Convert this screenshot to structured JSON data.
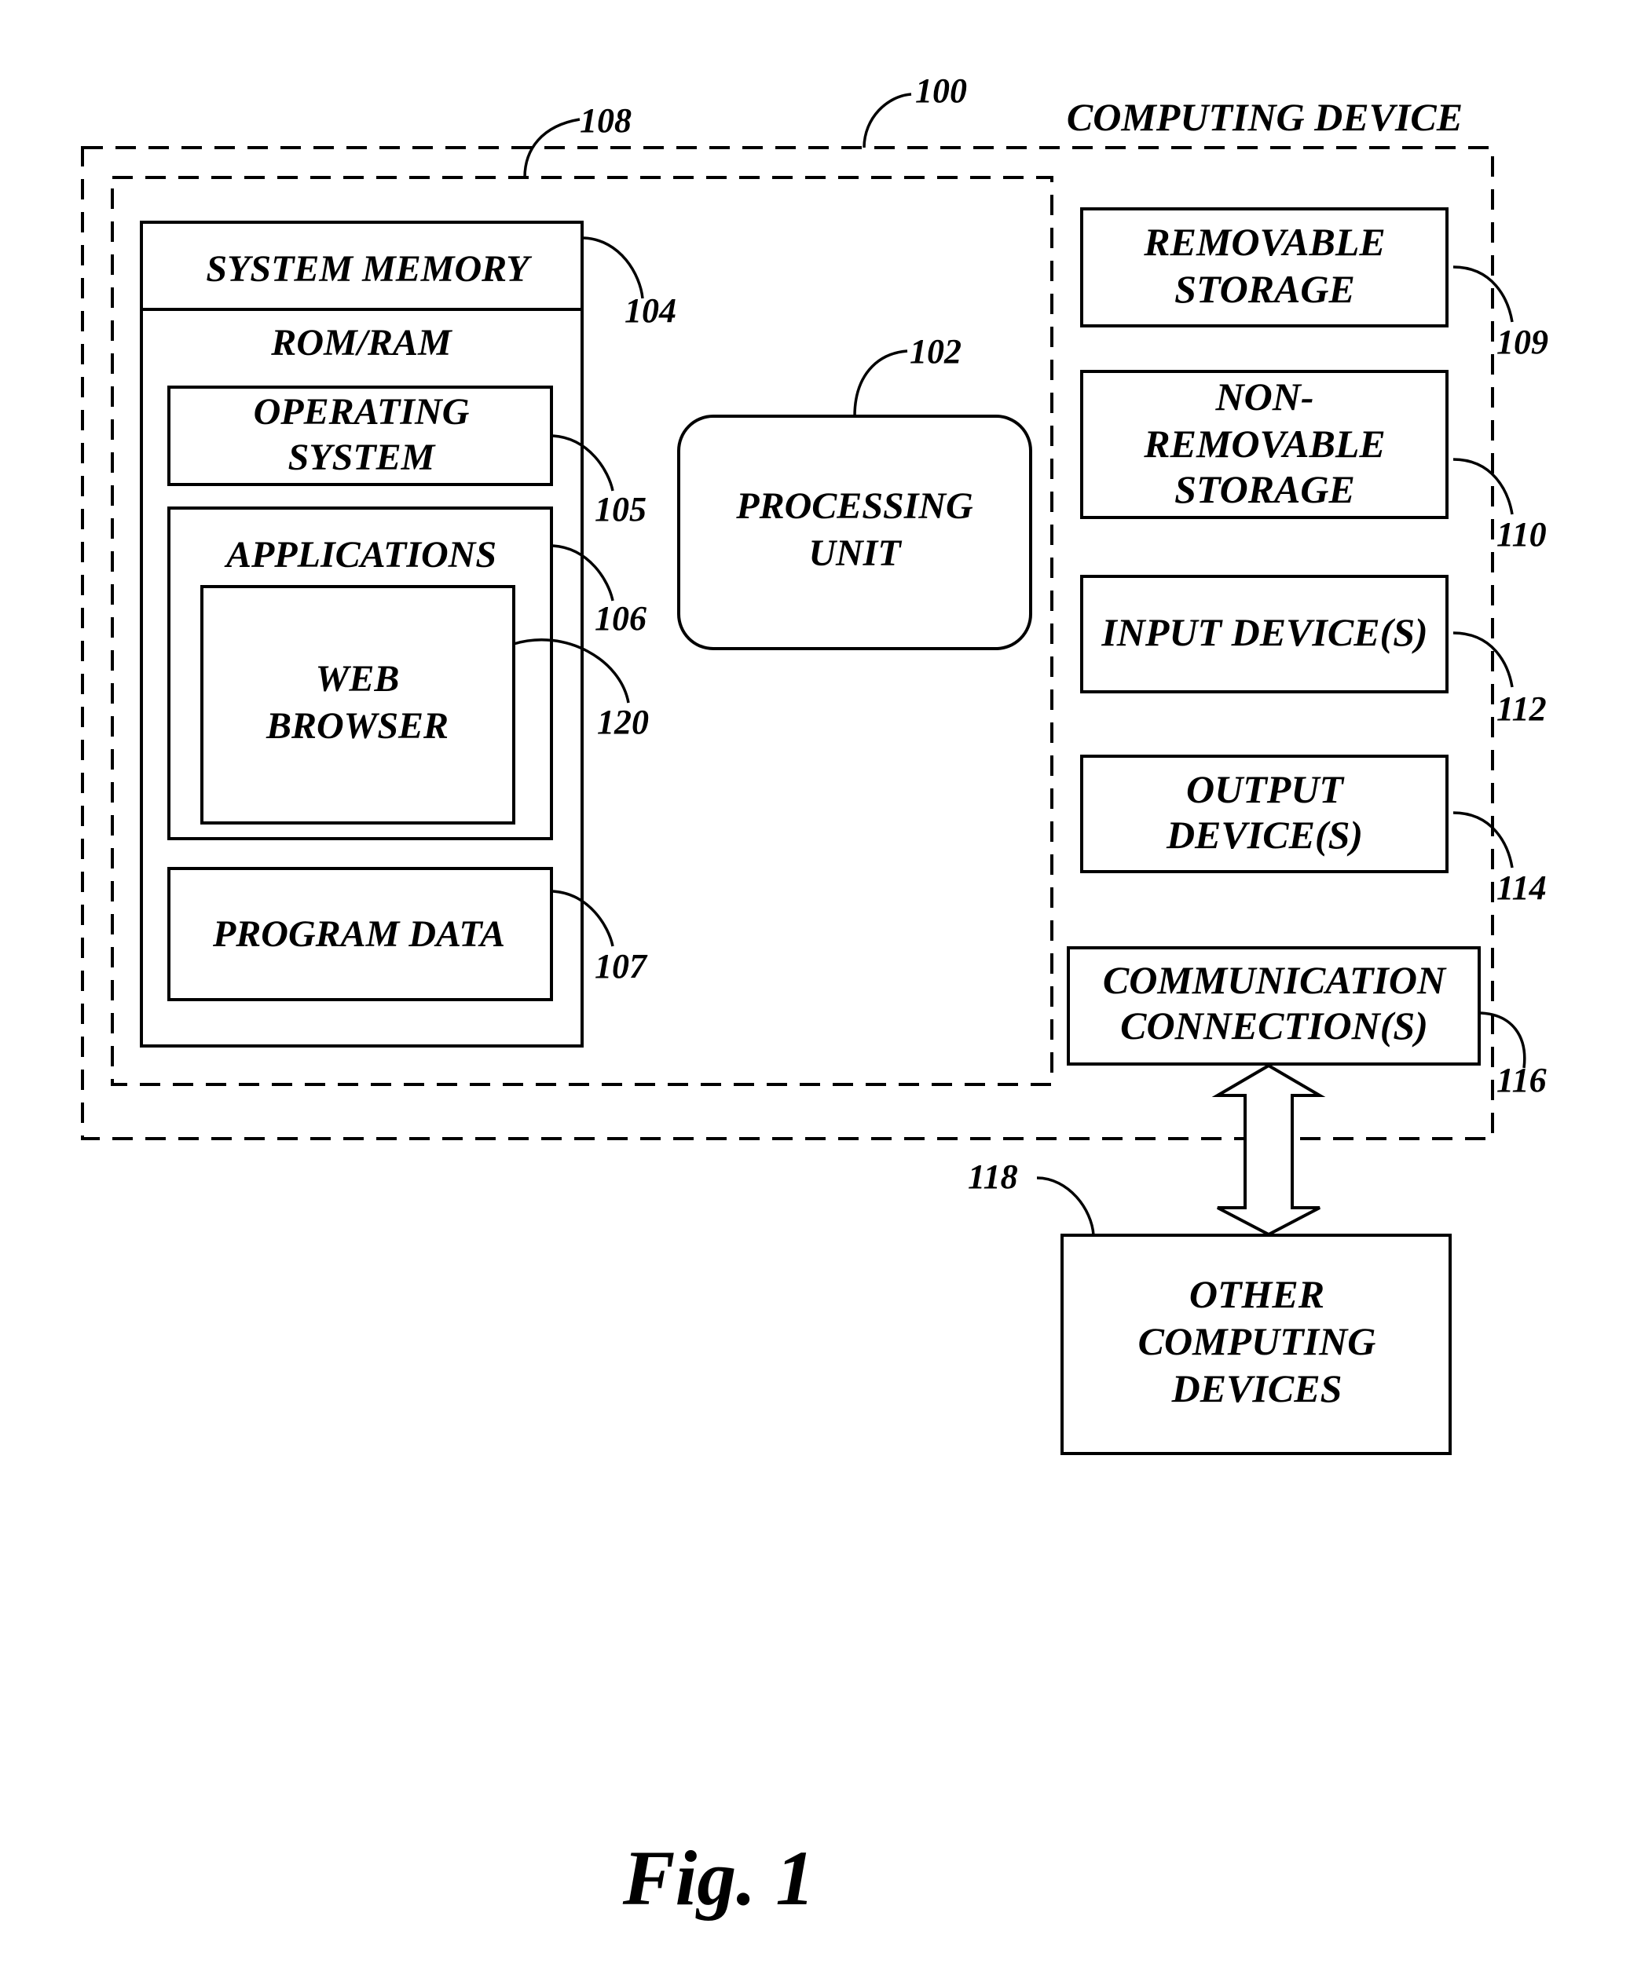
{
  "figure": {
    "caption": "Fig. 1",
    "title": "COMPUTING DEVICE",
    "refs": {
      "computing_device": "100",
      "processing_unit": "102",
      "system_memory": "104",
      "operating_system": "105",
      "applications": "106",
      "program_data": "107",
      "basic_config": "108",
      "removable_storage": "109",
      "non_removable_storage": "110",
      "input_devices": "112",
      "output_devices": "114",
      "communication_connections": "116",
      "other_computing_devices": "118",
      "web_browser": "120"
    },
    "boxes": {
      "system_memory": "SYSTEM MEMORY",
      "rom_ram": "ROM/RAM",
      "operating_system": [
        "OPERATING",
        "SYSTEM"
      ],
      "applications": "APPLICATIONS",
      "web_browser": [
        "WEB",
        "BROWSER"
      ],
      "program_data": "PROGRAM DATA",
      "processing_unit": [
        "PROCESSING",
        "UNIT"
      ],
      "removable_storage": [
        "REMOVABLE",
        "STORAGE"
      ],
      "non_removable_storage": [
        "NON-",
        "REMOVABLE",
        "STORAGE"
      ],
      "input_devices": "INPUT DEVICE(S)",
      "output_devices": [
        "OUTPUT",
        "DEVICE(S)"
      ],
      "communication_connections": [
        "COMMUNICATION",
        "CONNECTION(S)"
      ],
      "other_computing_devices": [
        "OTHER",
        "COMPUTING",
        "DEVICES"
      ]
    }
  }
}
